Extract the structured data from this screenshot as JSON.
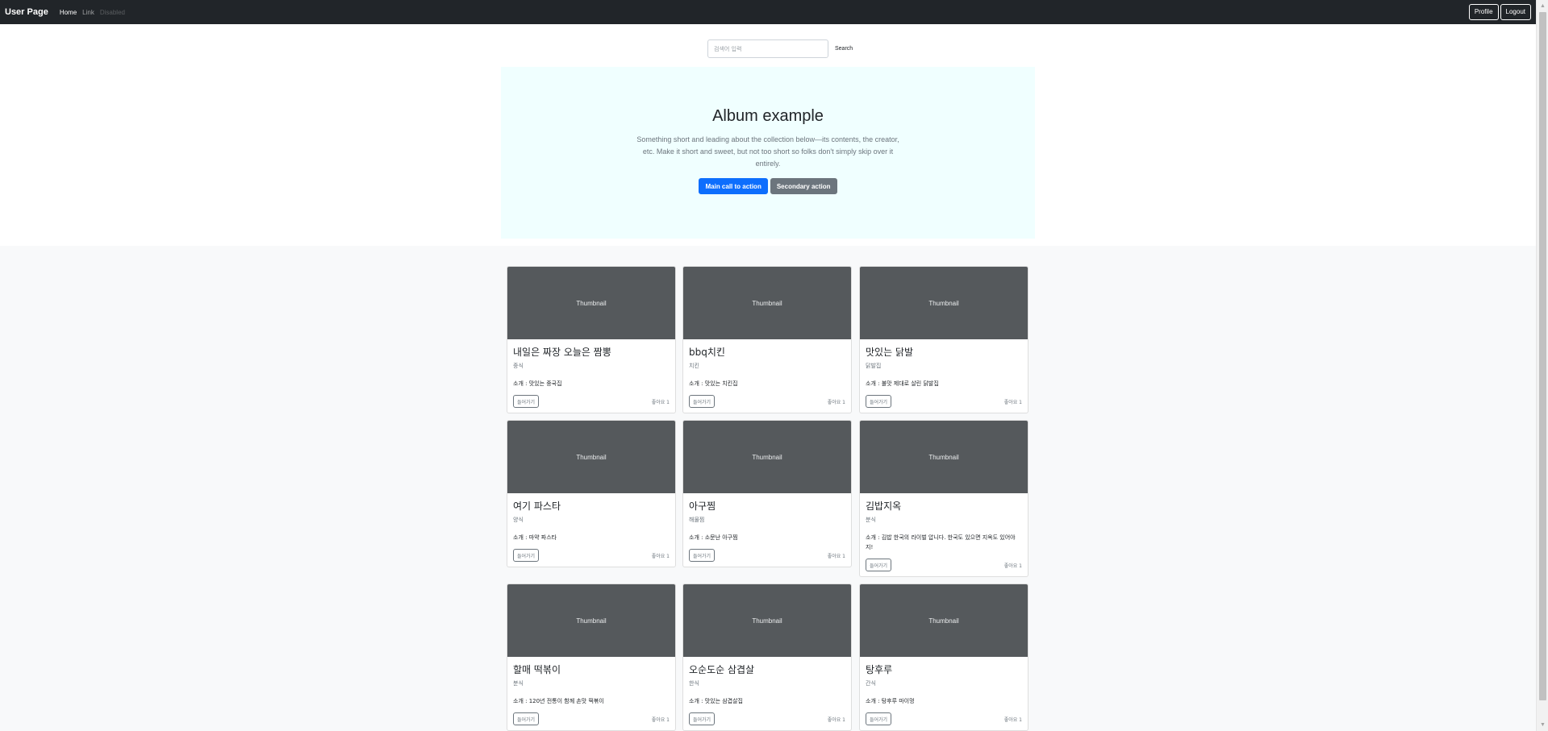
{
  "navbar": {
    "brand": "User Page",
    "links": [
      "Home",
      "Link",
      "Disabled"
    ],
    "profile_label": "Profile",
    "logout_label": "Logout"
  },
  "search": {
    "placeholder": "검색어 입력",
    "button_label": "Search"
  },
  "jumbotron": {
    "title": "Album example",
    "lead": "Something short and leading about the collection below—its contents, the creator, etc. Make it short and sweet, but not too short so folks don't simply skip over it entirely.",
    "primary_label": "Main call to action",
    "secondary_label": "Secondary action"
  },
  "cards": [
    {
      "thumbnail": "Thumbnail",
      "title": "내일은 짜장 오늘은 짬뽕",
      "category": "중식",
      "intro": "소개 : 맛있는 중국집",
      "button": "들어가기",
      "likes": "좋아요 1"
    },
    {
      "thumbnail": "Thumbnail",
      "title": "bbq치킨",
      "category": "치킨",
      "intro": "소개 : 맛있는 치킨집",
      "button": "들어가기",
      "likes": "좋아요 1"
    },
    {
      "thumbnail": "Thumbnail",
      "title": "맛있는 닭발",
      "category": "닭발집",
      "intro": "소개 : 불맛 제대로 살린 닭발집",
      "button": "들어가기",
      "likes": "좋아요 1"
    },
    {
      "thumbnail": "Thumbnail",
      "title": "여기 파스타",
      "category": "양식",
      "intro": "소개 : 마약 파스타",
      "button": "들어가기",
      "likes": "좋아요 1"
    },
    {
      "thumbnail": "Thumbnail",
      "title": "아구찜",
      "category": "해물찜",
      "intro": "소개 : 소문난 아구찜",
      "button": "들어가기",
      "likes": "좋아요 1"
    },
    {
      "thumbnail": "Thumbnail",
      "title": "김밥지옥",
      "category": "분식",
      "intro": "소개 : 김밥 한국의 라이벌 압니다. 한국도 있으면 지옥도 있어야지!",
      "button": "들어가기",
      "likes": "좋아요 1"
    },
    {
      "thumbnail": "Thumbnail",
      "title": "할매 떡볶이",
      "category": "분식",
      "intro": "소개 : 120년 전통이 함께 손맛 떡볶이",
      "button": "들어가기",
      "likes": "좋아요 1"
    },
    {
      "thumbnail": "Thumbnail",
      "title": "오순도순 삼겹살",
      "category": "한식",
      "intro": "소개 : 맛있는 삼겹살집",
      "button": "들어가기",
      "likes": "좋아요 1"
    },
    {
      "thumbnail": "Thumbnail",
      "title": "탕후루",
      "category": "간식",
      "intro": "소개 : 탕후루 마이멍",
      "button": "들어가기",
      "likes": "좋아요 1"
    }
  ],
  "scrollbar": {
    "up_icon": "▲",
    "down_icon": "▼"
  }
}
